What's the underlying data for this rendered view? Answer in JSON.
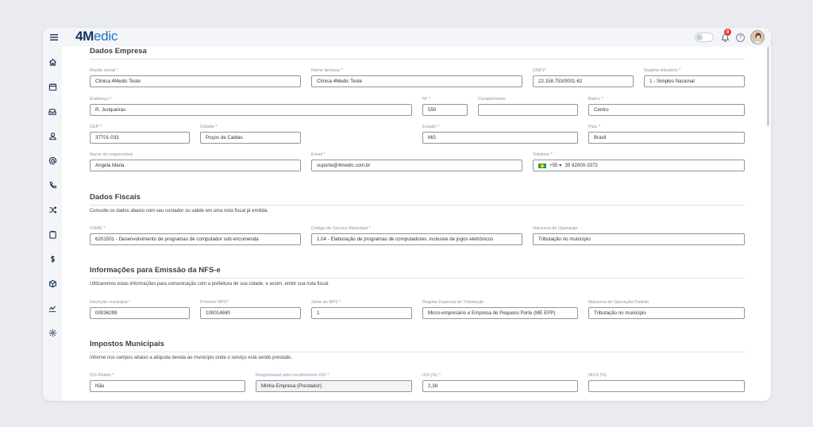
{
  "header": {
    "logo_num": "4",
    "logo_m": "M",
    "logo_rest": "edic",
    "notification_count": "0"
  },
  "sidebar": {
    "icons": [
      "home-icon",
      "calendar-icon",
      "inbox-icon",
      "user-icon",
      "at-icon",
      "phone-icon",
      "shuffle-icon",
      "clipboard-icon",
      "dollar-icon",
      "box-icon",
      "chart-icon",
      "settings-icon"
    ]
  },
  "sections": {
    "empresa": {
      "title": "Dados Empresa"
    },
    "fiscais": {
      "title": "Dados Fiscais",
      "desc": "Consulte os dados abaixo com seu contador ou valide em uma nota fiscal já emitida."
    },
    "nfse": {
      "title": "Informações para Emissão da NFS-e",
      "desc": "Utilizaremos estas informações para comunicação com a prefeitura de sua cidade, e assim, emitir sua nota fiscal."
    },
    "impostos": {
      "title": "Impostos Municipais",
      "desc": "Informe nos campos abaixo a alíquota devida ao município onde o serviço está sendo prestado."
    }
  },
  "fields": {
    "razao": {
      "label": "Razão social *",
      "value": "Clínica 4Medic Teste"
    },
    "fantasia": {
      "label": "Nome fantasia *",
      "value": "Clínica 4Medic Teste"
    },
    "cnpj": {
      "label": "CNPJ*",
      "value": "22.158.753/0001-62"
    },
    "regime": {
      "label": "Regime tributário *",
      "value": "1 - Simples Nacional"
    },
    "endereco": {
      "label": "Endereço *",
      "value": "R. Junqueiras"
    },
    "numero": {
      "label": "Nº *",
      "value": "550"
    },
    "complemento": {
      "label": "Complemento",
      "value": ""
    },
    "bairro": {
      "label": "Bairro *",
      "value": "Centro"
    },
    "cep": {
      "label": "CEP *",
      "value": "37701-033"
    },
    "cidade": {
      "label": "Cidade *",
      "value": "Poços de Caldas"
    },
    "estado": {
      "label": "Estado *",
      "value": "MG"
    },
    "pais": {
      "label": "País *",
      "value": "Brasil"
    },
    "responsavel": {
      "label": "Nome do responsável",
      "value": "Angela Maria"
    },
    "email": {
      "label": "Email *",
      "value": "suporte@4medic.com.br"
    },
    "telefone": {
      "label": "Telefone *",
      "code": "+55 ▾",
      "value": "35 92000-3372"
    },
    "cnae": {
      "label": "CNAE *",
      "value": "6201501 - Desenvolvimento de programas de computador sob encomenda"
    },
    "codigo_servico": {
      "label": "Código de Serviço Municipal *",
      "value": "1.04 - Elaboração de programas de computadores, inclusive de jogos eletrônicos"
    },
    "natureza": {
      "label": "Natureza de Operação",
      "value": "Tributação no município"
    },
    "inscricao": {
      "label": "Inscrição municipal *",
      "value": "00036299"
    },
    "rps": {
      "label": "Próximo RPS*",
      "value": "100014840"
    },
    "serie": {
      "label": "Série do RPS *",
      "value": "1"
    },
    "regime_especial": {
      "label": "Regime Especial de Tributação",
      "value": "Micro-empresário e Empresa de Pequeno Porte (ME EPP)"
    },
    "natureza_padrao": {
      "label": "Natureza de Operação Padrão",
      "value": "Tributação no município"
    },
    "iss_retido": {
      "label": "ISS Retido *",
      "value": "Não"
    },
    "responsavel_iss": {
      "label": "Responsável pelo recolhimento ISS *",
      "value": "Minha Empresa (Prestador)"
    },
    "iss": {
      "label": "ISS (%) *",
      "value": "2,38"
    },
    "inss": {
      "label": "INSS (%)",
      "value": ""
    }
  }
}
